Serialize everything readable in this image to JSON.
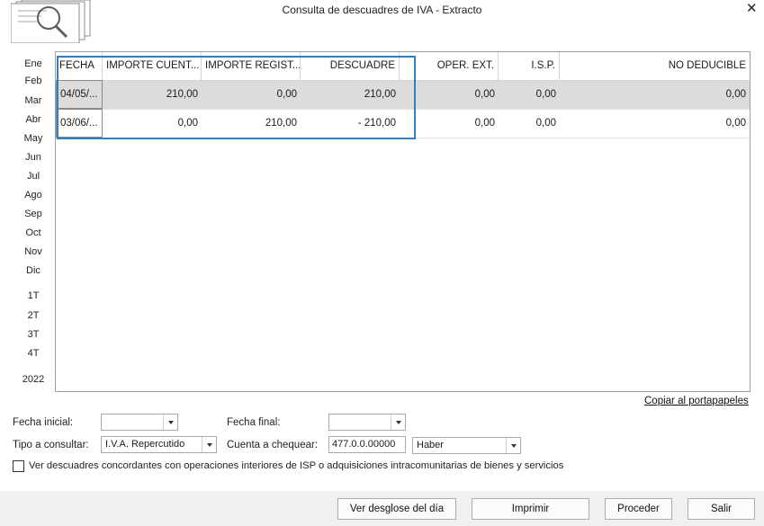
{
  "window": {
    "title": "Consulta de descuadres de IVA - Extracto",
    "close_glyph": "✕"
  },
  "periods": [
    "Ene",
    "Feb",
    "Mar",
    "Abr",
    "May",
    "Jun",
    "Jul",
    "Ago",
    "Sep",
    "Oct",
    "Nov",
    "Dic"
  ],
  "quarters": [
    "1T",
    "2T",
    "3T",
    "4T"
  ],
  "year": "2022",
  "table": {
    "columns": [
      "FECHA",
      "IMPORTE CUENT...",
      "IMPORTE REGIST...",
      "DESCUADRE",
      "OPER. EXT.",
      "I.S.P.",
      "NO DEDUCIBLE"
    ],
    "rows": [
      [
        "04/05/...",
        "210,00",
        "0,00",
        "210,00",
        "0,00",
        "0,00",
        "0,00"
      ],
      [
        "03/06/...",
        "0,00",
        "210,00",
        "- 210,00",
        "0,00",
        "0,00",
        "0,00"
      ]
    ],
    "highlight_color": "#2f7fc1"
  },
  "copy_link": "Copiar al portapapeles",
  "filters": {
    "fecha_inicial_label": "Fecha inicial:",
    "fecha_inicial_value": "",
    "fecha_final_label": "Fecha final:",
    "fecha_final_value": "",
    "tipo_label": "Tipo a consultar:",
    "tipo_value": "I.V.A. Repercutido",
    "cuenta_label": "Cuenta a chequear:",
    "cuenta_value": "477.0.0.00000",
    "lado_value": "Haber"
  },
  "checkbox_label": "Ver descuadres concordantes con operaciones interiores de ISP o adquisiciones intracomunitarias de bienes y servicios",
  "buttons": {
    "desglose": "Ver desglose del día",
    "imprimir": "Imprimir",
    "proceder": "Proceder",
    "salir": "Salir"
  }
}
